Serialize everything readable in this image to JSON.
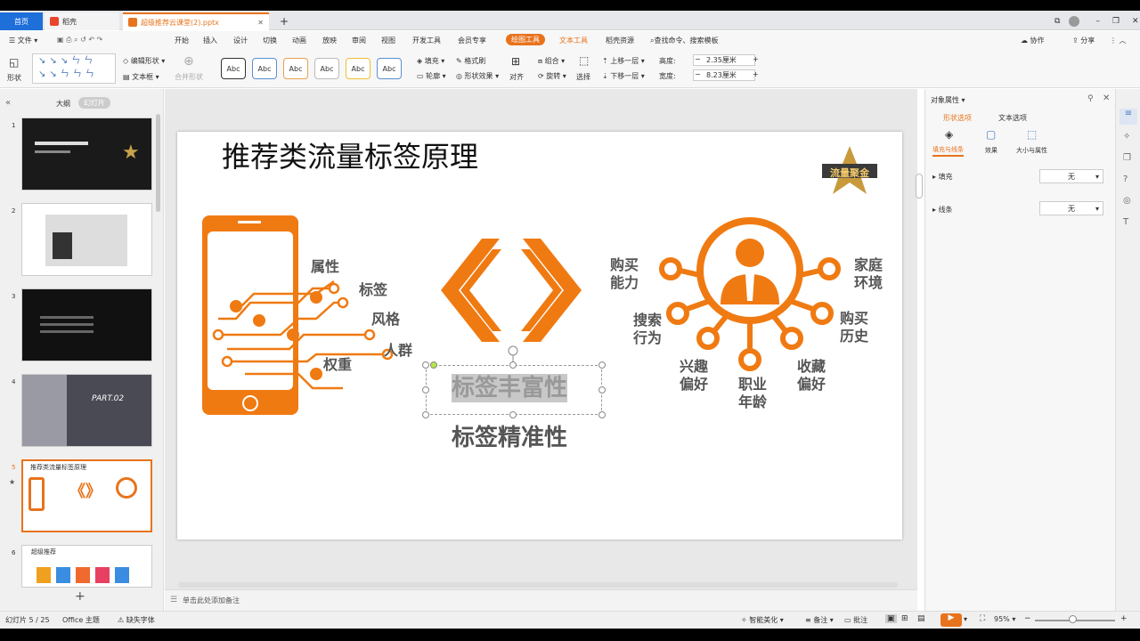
{
  "tabs": {
    "home": "首页",
    "doc": "稻壳",
    "file": "超级推荐云课堂(2).pptx",
    "add": "+"
  },
  "menu": {
    "file": "文件",
    "items": [
      "开始",
      "插入",
      "设计",
      "切换",
      "动画",
      "放映",
      "审阅",
      "视图",
      "开发工具",
      "会员专享"
    ],
    "drawing_tools": "绘图工具",
    "text_tools": "文本工具",
    "template": "稻壳资源",
    "search": "查找命令、搜索模板",
    "collab": "协作",
    "share": "分享"
  },
  "toolbar": {
    "shape": "形状",
    "edit_shape": "编辑形状",
    "textbox": "文本框",
    "merge": "合并形状",
    "abc": "Abc",
    "fill": "填充",
    "format_brush": "格式刷",
    "outline": "轮廓",
    "shape_effect": "形状效果",
    "group": "组合",
    "rotate": "旋转",
    "align": "对齐",
    "select": "选择",
    "up": "上移一层",
    "down": "下移一层",
    "height_label": "高度:",
    "width_label": "宽度:",
    "height_val": "2.35厘米",
    "width_val": "8.23厘米"
  },
  "leftpanel": {
    "outline": "大纲",
    "slides": "幻灯片"
  },
  "thumbs": [
    {
      "num": "1"
    },
    {
      "num": "2"
    },
    {
      "num": "3"
    },
    {
      "num": "4",
      "title": "PART.02"
    },
    {
      "num": "5",
      "title": "推荐类流量标签原理"
    },
    {
      "num": "6",
      "title": "超级推荐"
    }
  ],
  "slide": {
    "title": "推荐类流量标签原理",
    "logo": "流量聚金",
    "left_labels": [
      "属性",
      "标签",
      "风格",
      "人群",
      "权重"
    ],
    "center_selected": "标签丰富性",
    "center_bottom": "标签精准性",
    "right_labels": [
      "购买\n能力",
      "搜索\n行为",
      "兴趣\n偏好",
      "职业\n年龄",
      "收藏\n偏好",
      "购买\n历史",
      "家庭\n环境"
    ]
  },
  "notes": {
    "placeholder": "单击此处添加备注"
  },
  "rightpanel": {
    "title": "对象属性",
    "tab_shape": "形状选项",
    "tab_text": "文本选项",
    "sub_fill": "填充与线条",
    "sub_effect": "效果",
    "sub_size": "大小与属性",
    "fill_label": "填充",
    "line_label": "线条",
    "fill_val": "无",
    "line_val": "无"
  },
  "status": {
    "slide_pos": "幻灯片 5 / 25",
    "theme": "Office 主题",
    "font": "缺失字体",
    "beautify": "智能美化",
    "notes": "备注",
    "comment": "批注",
    "zoom": "95%"
  },
  "colors": {
    "accent": "#e8731c",
    "brand_blue": "#1e6fd9"
  }
}
